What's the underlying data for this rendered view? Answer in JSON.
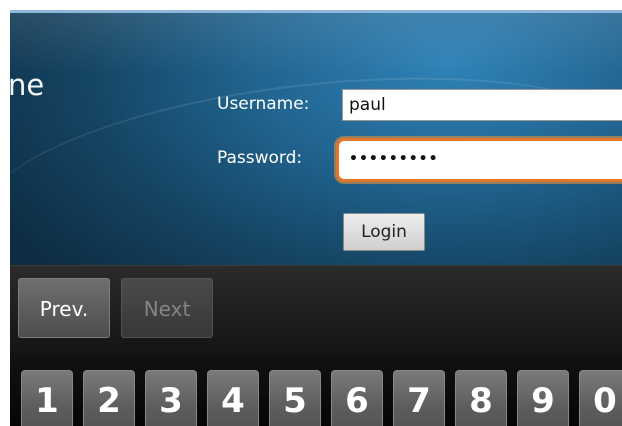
{
  "app": {
    "title_fragment": "ne"
  },
  "login_form": {
    "username_label": "Username:",
    "username_value": "paul",
    "password_label": "Password:",
    "password_masked": "•••••••••",
    "login_button": "Login"
  },
  "navigation": {
    "prev_label": "Prev.",
    "next_label": "Next"
  },
  "keyboard": {
    "keys": [
      "1",
      "2",
      "3",
      "4",
      "5",
      "6",
      "7",
      "8",
      "9",
      "0"
    ]
  },
  "colors": {
    "focus_outline": "#e2772b",
    "background_blue": "#21648f"
  }
}
